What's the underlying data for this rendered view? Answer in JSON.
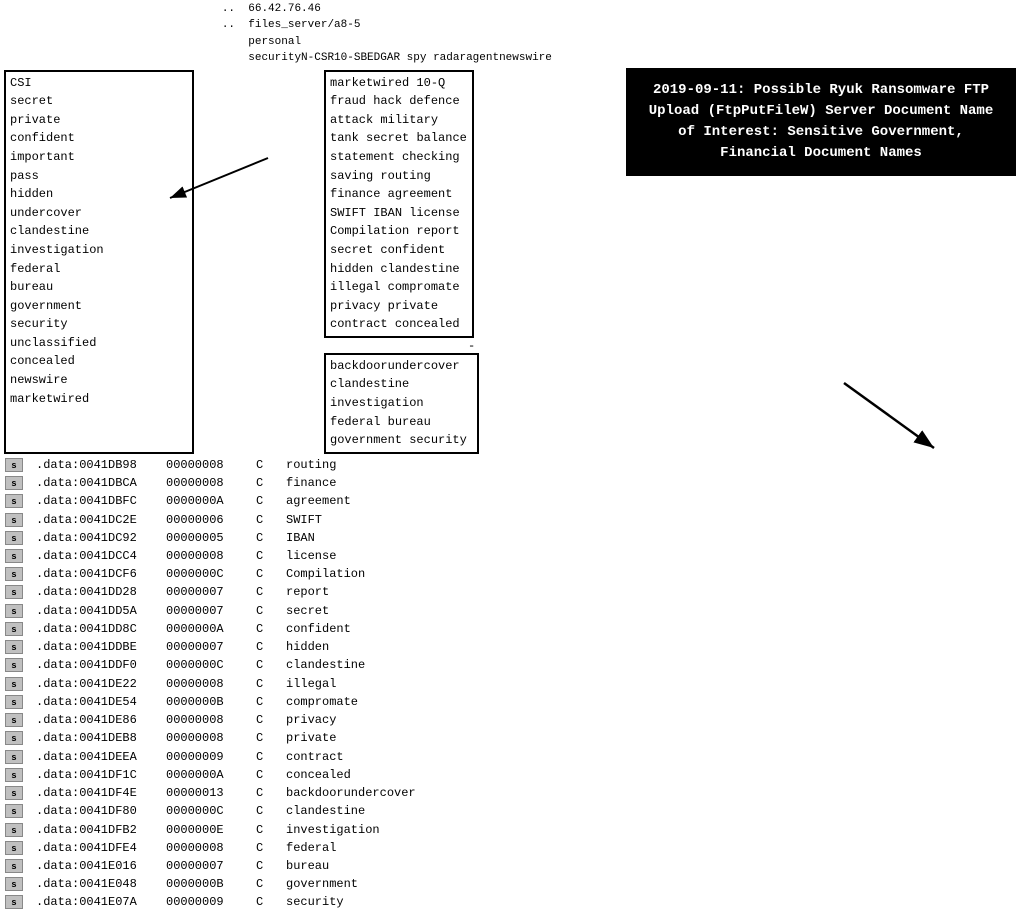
{
  "header": {
    "line1": "                                                    ..  66.42.76.46",
    "line2": "                                                    ..  files_server/a8-5",
    "line3": "                                                        personal",
    "line4": "                                                        securityN-CSR10-SBEDGAR spy radaragentnewswire"
  },
  "left_box_words": [
    "CSI",
    "secret",
    "private",
    "confident",
    "important",
    "pass",
    "hidden",
    "undercover",
    "clandestine",
    "investigation",
    "federal",
    "bureau",
    "government",
    "security",
    "unclassified",
    "concealed",
    "newswire",
    "marketwired"
  ],
  "middle_top_words": [
    "marketwired",
    "10-Q",
    "fraud",
    "hack",
    "defence",
    "attack",
    "military",
    "tank",
    "secret",
    "balance",
    "statement",
    "checking",
    "saving",
    "routing",
    "finance",
    "agreement",
    "SWIFT",
    "IBAN",
    "license",
    "Compilation",
    "report",
    "secret",
    "confident",
    "hidden",
    "clandestine",
    "illegal",
    "compromate",
    "privacy",
    "private",
    "contract",
    "concealed"
  ],
  "bottom_box_words": [
    "backdoorundercover",
    "clandestine",
    "investigation",
    "federal",
    "bureau",
    "government",
    "security"
  ],
  "annotation": {
    "text": "2019-09-11: Possible Ryuk Ransomware FTP Upload (FtpPutFileW) Server Document Name of Interest: Sensitive Government, Financial Document Names"
  },
  "table_rows": [
    {
      "addr": ".data:0041DB98",
      "hex": "00000008",
      "c": "C",
      "word": "routing"
    },
    {
      "addr": ".data:0041DBCA",
      "hex": "00000008",
      "c": "C",
      "word": "finance"
    },
    {
      "addr": ".data:0041DBFC",
      "hex": "0000000A",
      "c": "C",
      "word": "agreement"
    },
    {
      "addr": ".data:0041DC2E",
      "hex": "00000006",
      "c": "C",
      "word": "SWIFT"
    },
    {
      "addr": ".data:0041DC92",
      "hex": "00000005",
      "c": "C",
      "word": "IBAN"
    },
    {
      "addr": ".data:0041DCC4",
      "hex": "00000008",
      "c": "C",
      "word": "license"
    },
    {
      "addr": ".data:0041DCF6",
      "hex": "0000000C",
      "c": "C",
      "word": "Compilation"
    },
    {
      "addr": ".data:0041DD28",
      "hex": "00000007",
      "c": "C",
      "word": "report"
    },
    {
      "addr": ".data:0041DD5A",
      "hex": "00000007",
      "c": "C",
      "word": "secret"
    },
    {
      "addr": ".data:0041DD8C",
      "hex": "0000000A",
      "c": "C",
      "word": "confident"
    },
    {
      "addr": ".data:0041DDBE",
      "hex": "00000007",
      "c": "C",
      "word": "hidden"
    },
    {
      "addr": ".data:0041DDF0",
      "hex": "0000000C",
      "c": "C",
      "word": "clandestine"
    },
    {
      "addr": ".data:0041DE22",
      "hex": "00000008",
      "c": "C",
      "word": "illegal"
    },
    {
      "addr": ".data:0041DE54",
      "hex": "0000000B",
      "c": "C",
      "word": "compromate"
    },
    {
      "addr": ".data:0041DE86",
      "hex": "00000008",
      "c": "C",
      "word": "privacy"
    },
    {
      "addr": ".data:0041DEB8",
      "hex": "00000008",
      "c": "C",
      "word": "private"
    },
    {
      "addr": ".data:0041DEEA",
      "hex": "00000009",
      "c": "C",
      "word": "contract"
    },
    {
      "addr": ".data:0041DF1C",
      "hex": "0000000A",
      "c": "C",
      "word": "concealed"
    },
    {
      "addr": ".data:0041DF4E",
      "hex": "00000013",
      "c": "C",
      "word": "backdoorundercover"
    },
    {
      "addr": ".data:0041DF80",
      "hex": "0000000C",
      "c": "C",
      "word": "clandestine"
    },
    {
      "addr": ".data:0041DFB2",
      "hex": "0000000E",
      "c": "C",
      "word": "investigation"
    },
    {
      "addr": ".data:0041DFE4",
      "hex": "00000008",
      "c": "C",
      "word": "federal"
    },
    {
      "addr": ".data:0041E016",
      "hex": "00000007",
      "c": "C",
      "word": "bureau"
    },
    {
      "addr": ".data:0041E048",
      "hex": "0000000B",
      "c": "C",
      "word": "government"
    },
    {
      "addr": ".data:0041E07A",
      "hex": "00000009",
      "c": "C",
      "word": "security"
    }
  ],
  "icons": {
    "s_label": "s"
  }
}
